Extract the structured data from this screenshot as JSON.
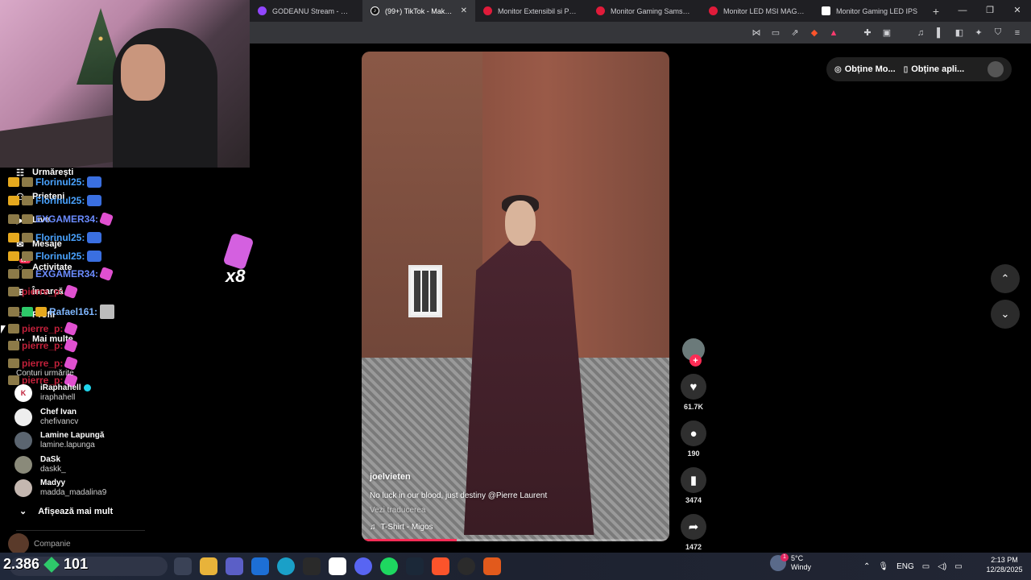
{
  "browser": {
    "tabs": [
      {
        "label": "GODEANU Stream - Watc",
        "color": "#9146ff",
        "active": false
      },
      {
        "label": "(99+) TikTok - Make Y",
        "color": "#111111",
        "active": true
      },
      {
        "label": "Monitor Extensibil si Porta",
        "color": "#e01b3a",
        "active": false
      },
      {
        "label": "Monitor Gaming Samsung",
        "color": "#e01b3a",
        "active": false
      },
      {
        "label": "Monitor LED MSI MAG 27",
        "color": "#e01b3a",
        "active": false
      },
      {
        "label": "Monitor Gaming LED IPS",
        "color": "#ffffff",
        "active": false
      }
    ],
    "new_tab": "+",
    "close_glyph": "✕"
  },
  "sidebar": {
    "nav": [
      {
        "label": "Urmărești",
        "icon": "following-icon"
      },
      {
        "label": "Prieteni",
        "icon": "friends-icon"
      },
      {
        "label": "Live",
        "icon": "live-icon"
      },
      {
        "label": "Mesaje",
        "icon": "messages-icon"
      },
      {
        "label": "Activitate",
        "icon": "activity-icon",
        "badge": "99+"
      },
      {
        "label": "Încarcă",
        "icon": "upload-icon"
      },
      {
        "label": "Profil",
        "icon": "profile-icon"
      },
      {
        "label": "Mai multe",
        "icon": "more-icon"
      }
    ],
    "chat": [
      {
        "user": "Florinul25:",
        "color": "#4aa3ff"
      },
      {
        "user": "Florinul25:",
        "color": "#4aa3ff"
      },
      {
        "user": "EXGAMER34:",
        "color": "#6b8cff"
      },
      {
        "user": "Florinul25:",
        "color": "#4aa3ff"
      },
      {
        "user": "Florinul25:",
        "color": "#4aa3ff"
      },
      {
        "user": "EXGAMER34:",
        "color": "#6b8cff"
      },
      {
        "user": "pierre_p:",
        "color": "#c0203a"
      },
      {
        "user": "Rafael161:",
        "color": "#7fb7ff"
      },
      {
        "user": "pierre_p:",
        "color": "#c0203a"
      },
      {
        "user": "pierre_p:",
        "color": "#c0203a"
      },
      {
        "user": "pierre_p:",
        "color": "#c0203a"
      },
      {
        "user": "pierre_p:",
        "color": "#c0203a"
      }
    ],
    "following_title": "Conturi urmărite",
    "accounts": [
      {
        "name": "iRaphahell",
        "handle": "iraphahell",
        "verified": true
      },
      {
        "name": "Chef Ivan",
        "handle": "chefivancv",
        "verified": false
      },
      {
        "name": "Lamine Lapungă",
        "handle": "lamine.lapunga",
        "verified": false
      },
      {
        "name": "DaSk",
        "handle": "daskk_",
        "verified": false
      },
      {
        "name": "Madyy",
        "handle": "madda_madalina9",
        "verified": false
      }
    ],
    "show_more": "Afișează mai mult",
    "company": "Companie"
  },
  "overlay": {
    "multiplier": "x8",
    "taskbar_counter": "2.386",
    "taskbar_counter2": "101"
  },
  "video": {
    "username": "joelvieten",
    "caption": "No luck in our blood, just destiny @Pierre Laurent",
    "translate": "Vezi traducerea",
    "music": "T-Shirt - Migos",
    "progress": 0.31
  },
  "actions": {
    "likes": "61.7K",
    "comments": "190",
    "saves": "3474",
    "shares": "1472"
  },
  "topbar": {
    "get_coins": "Obține Mo...",
    "get_app": "Obține apli..."
  },
  "taskbar": {
    "weather_temp": "5°C",
    "weather_desc": "Windy",
    "weather_badge": "1",
    "lang": "ENG",
    "time": "2:13 PM",
    "date": "12/28/2025"
  }
}
